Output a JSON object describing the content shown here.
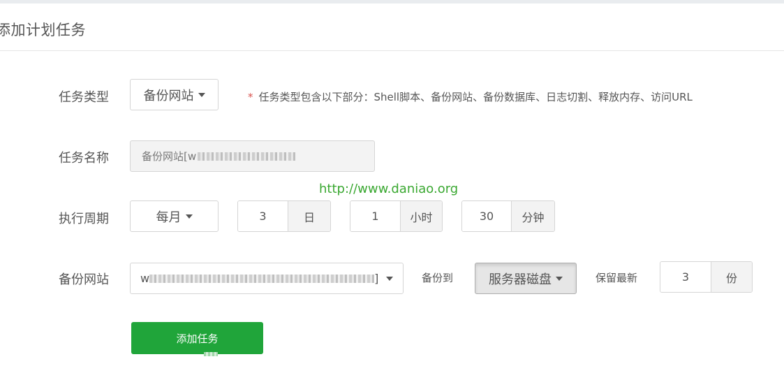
{
  "header": {
    "title": "添加计划任务"
  },
  "task_type": {
    "label": "任务类型",
    "selected": "备份网站",
    "note_star": "*",
    "note": "任务类型包含以下部分：Shell脚本、备份网站、备份数据库、日志切割、释放内存、访问URL"
  },
  "task_name": {
    "label": "任务名称",
    "value_prefix": "备份网站[w"
  },
  "watermark": "http://www.daniao.org",
  "period": {
    "label": "执行周期",
    "selected": "每月",
    "day_value": "3",
    "day_unit": "日",
    "hour_value": "1",
    "hour_unit": "小时",
    "minute_value": "30",
    "minute_unit": "分钟"
  },
  "backup": {
    "label": "备份网站",
    "site_prefix": "w",
    "site_suffix": "]",
    "backup_to_label": "备份到",
    "destination": "服务器磁盘",
    "keep_label": "保留最新",
    "keep_value": "3",
    "keep_unit": "份"
  },
  "submit_label": "添加任务",
  "colors": {
    "primary": "#20a53a",
    "watermark": "#3aa831",
    "required": "#d9534f"
  }
}
